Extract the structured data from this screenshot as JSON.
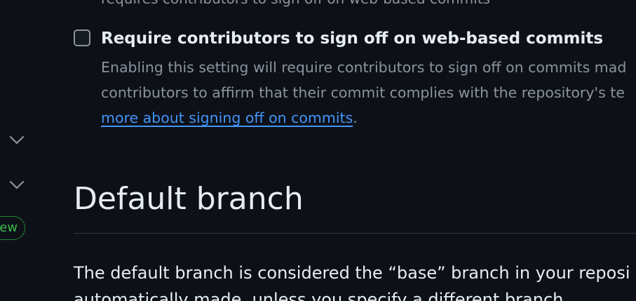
{
  "top_fragment": "requires contributors to sign off on web-based commits",
  "sidebar": {
    "chevrons": [
      "chevron-down-icon",
      "chevron-down-icon"
    ],
    "badge": "New"
  },
  "signoff_option": {
    "label": "Require contributors to sign off on web-based commits",
    "description_line1": "Enabling this setting will require contributors to sign off on commits mad",
    "description_line2": "contributors to affirm that their commit complies with the repository's te",
    "link_text": "more about signing off on commits",
    "period": ".",
    "checked": false
  },
  "default_branch": {
    "heading": "Default branch",
    "body_line1": "The default branch is considered the “base” branch in your reposi",
    "body_line2": "automatically made, unless you specify a different branch."
  },
  "colors": {
    "background": "#0d1117",
    "text": "#e6edf3",
    "muted": "#8b949e",
    "link": "#4493f8",
    "success": "#3fb950"
  }
}
